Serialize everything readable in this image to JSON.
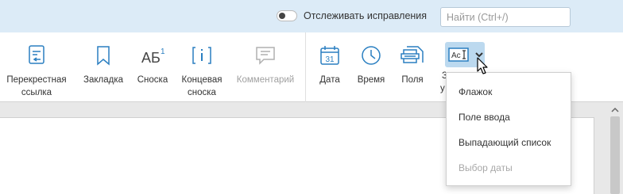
{
  "topbar": {
    "track_changes_label": "Отслеживать исправления",
    "track_changes_on": false,
    "search_placeholder": "Найти (Ctrl+/)"
  },
  "ribbon": {
    "cross_ref": {
      "label": "Перекрестная\nссылка",
      "icon": "cross-reference-icon"
    },
    "bookmark": {
      "label": "Закладка",
      "icon": "bookmark-icon"
    },
    "footnote": {
      "label": "Сноска",
      "icon": "footnote-icon"
    },
    "endnote": {
      "label": "Концевая\nсноска",
      "icon": "endnote-icon"
    },
    "comment": {
      "label": "Комментарий",
      "icon": "comment-icon",
      "disabled": true
    },
    "date": {
      "label": "Дата",
      "icon": "calendar-icon",
      "icon_text": "31"
    },
    "time": {
      "label": "Время",
      "icon": "clock-icon"
    },
    "fields": {
      "label": "Поля",
      "icon": "fields-icon"
    },
    "content_control": {
      "icon": "content-control-icon",
      "partial_label_1": "З",
      "partial_label_2": "у"
    }
  },
  "dropdown": {
    "items": [
      {
        "label": "Флажок",
        "disabled": false
      },
      {
        "label": "Поле ввода",
        "disabled": false
      },
      {
        "label": "Выпадающий список",
        "disabled": false
      },
      {
        "label": "Выбор даты",
        "disabled": true
      }
    ]
  },
  "colors": {
    "accent": "#2a7fc1",
    "topbar_bg": "#dcebf7",
    "active_button_bg": "#bcd9ef",
    "disabled_text": "#a0a0a0"
  }
}
